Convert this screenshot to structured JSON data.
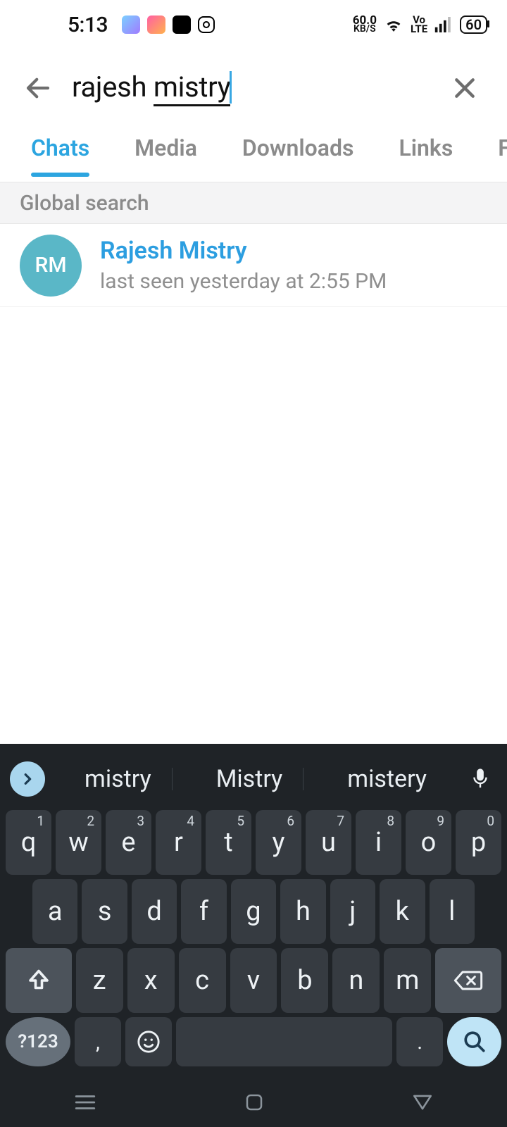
{
  "status": {
    "time": "5:13",
    "net_speed_top": "60.0",
    "net_speed_sub": "KB/S",
    "volte_top": "Vo",
    "volte_sub": "LTE",
    "battery": "60"
  },
  "search": {
    "value_first": "rajesh ",
    "value_underlined": "mistry"
  },
  "tabs": {
    "chats": "Chats",
    "media": "Media",
    "downloads": "Downloads",
    "links": "Links",
    "files_trunc": "F"
  },
  "section": {
    "global_search": "Global search"
  },
  "result": {
    "initials": "RM",
    "name": "Rajesh Mistry",
    "status": "last seen yesterday at 2:55 PM"
  },
  "keyboard": {
    "sugg1": "mistry",
    "sugg2": "Mistry",
    "sugg3": "mistery",
    "numkey": "?123",
    "row1": [
      {
        "c": "q",
        "n": "1"
      },
      {
        "c": "w",
        "n": "2"
      },
      {
        "c": "e",
        "n": "3"
      },
      {
        "c": "r",
        "n": "4"
      },
      {
        "c": "t",
        "n": "5"
      },
      {
        "c": "y",
        "n": "6"
      },
      {
        "c": "u",
        "n": "7"
      },
      {
        "c": "i",
        "n": "8"
      },
      {
        "c": "o",
        "n": "9"
      },
      {
        "c": "p",
        "n": "0"
      }
    ],
    "row2": [
      "a",
      "s",
      "d",
      "f",
      "g",
      "h",
      "j",
      "k",
      "l"
    ],
    "row3": [
      "z",
      "x",
      "c",
      "v",
      "b",
      "n",
      "m"
    ],
    "comma": ",",
    "period": "."
  }
}
